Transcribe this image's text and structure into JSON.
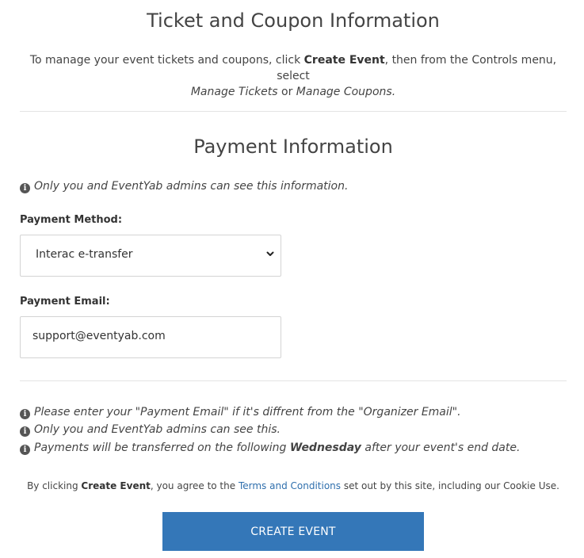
{
  "tickets_section": {
    "title": "Ticket and Coupon Information",
    "intro_prefix": "To manage your event tickets and coupons, click ",
    "intro_action": "Create Event",
    "intro_mid": ", then from the Controls menu, select",
    "intro_option1": "Manage Tickets",
    "intro_or": " or ",
    "intro_option2": "Manage Coupons",
    "intro_suffix": "."
  },
  "payment_section": {
    "title": "Payment Information",
    "privacy_note": "Only you and EventYab admins can see this information.",
    "method_label": "Payment Method:",
    "method_value": "Interac e-transfer",
    "email_label": "Payment Email:",
    "email_value": "support@eventyab.com"
  },
  "notes": {
    "note1": "Please enter your \"Payment Email\" if it's diffrent from the \"Organizer Email\".",
    "note2": "Only you and EventYab admins can see this.",
    "note3_prefix": "Payments will be transferred on the following ",
    "note3_day": "Wednesday",
    "note3_suffix": " after your event's end date."
  },
  "footer": {
    "agree_prefix": "By clicking ",
    "agree_action": "Create Event",
    "agree_mid": ", you agree to the ",
    "terms_link": "Terms and Conditions",
    "agree_suffix": " set out by this site, including our Cookie Use.",
    "create_button": "CREATE EVENT"
  },
  "icons": {
    "info_glyph": "i"
  },
  "colors": {
    "primary_button": "#3477b8",
    "link": "#2f6fad"
  }
}
